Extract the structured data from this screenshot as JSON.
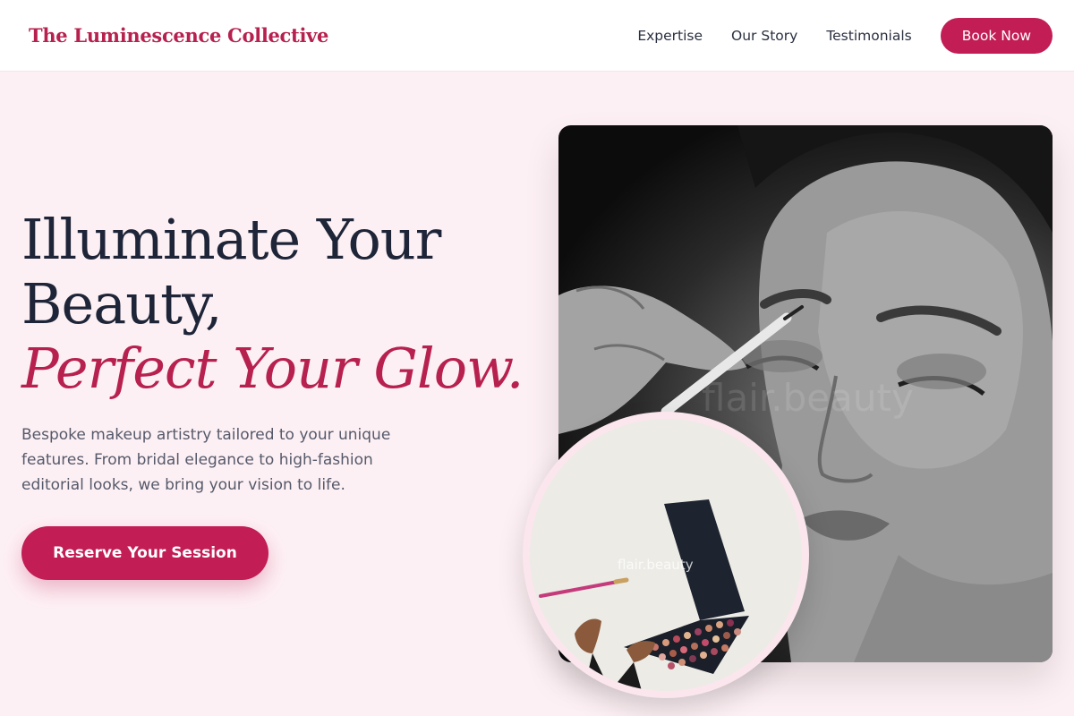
{
  "header": {
    "logo": "The Luminescence Collective",
    "nav": [
      "Expertise",
      "Our Story",
      "Testimonials"
    ],
    "book_label": "Book Now"
  },
  "hero": {
    "headline_line1": "Illuminate Your",
    "headline_line2": "Beauty,",
    "headline_accent": "Perfect Your Glow.",
    "subtitle": "Bespoke makeup artistry tailored to your unique features. From bridal elegance to high-fashion editorial looks, we bring your vision to life.",
    "cta_label": "Reserve Your Session"
  },
  "images": {
    "main_watermark": "flair.beauty",
    "circle_watermark": "flair.beauty"
  },
  "colors": {
    "accent": "#c21d55",
    "background": "#fdf0f4",
    "heading": "#1e2538"
  }
}
